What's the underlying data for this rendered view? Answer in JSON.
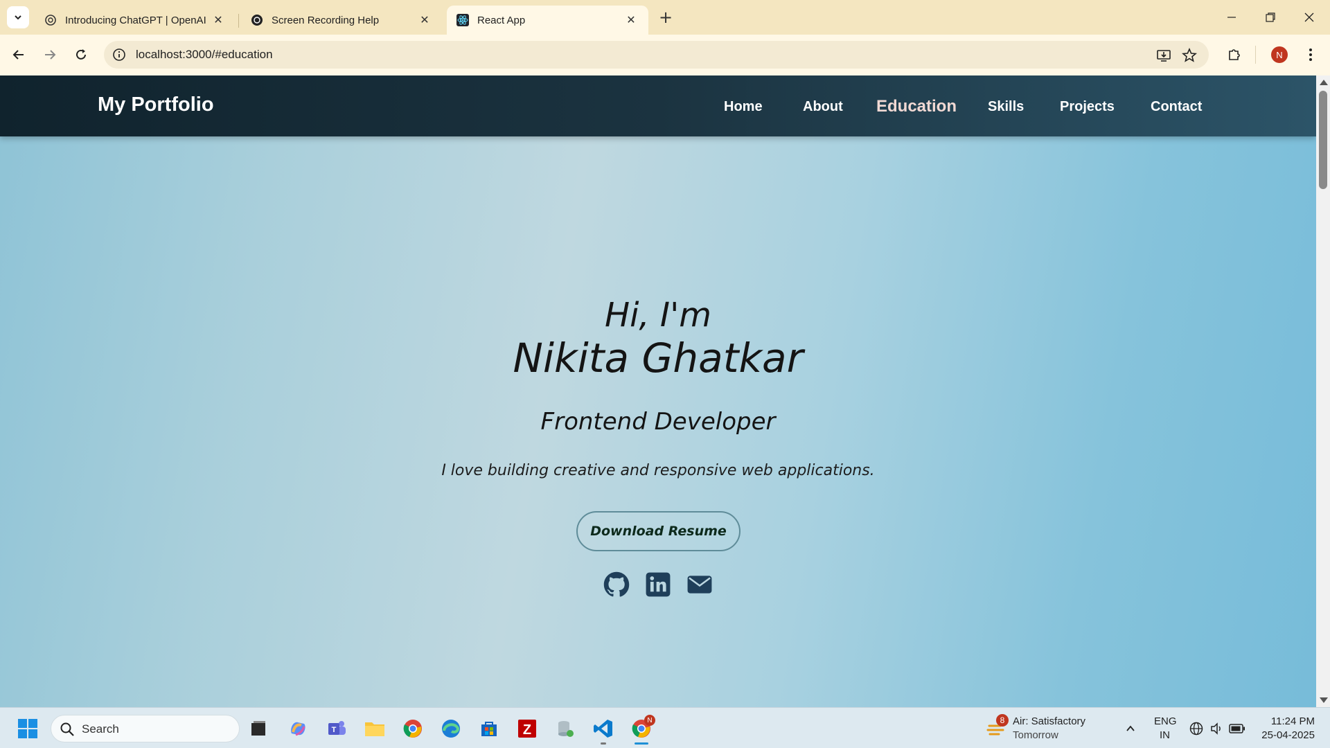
{
  "browser": {
    "tabs": [
      {
        "title": "Introducing ChatGPT | OpenAI",
        "close": "✕"
      },
      {
        "title": "Screen Recording Help",
        "close": "✕"
      },
      {
        "title": "React App",
        "close": "✕"
      }
    ],
    "new_tab": "+",
    "url": "localhost:3000/#education",
    "profile_initial": "N"
  },
  "site": {
    "brand": "My Portfolio",
    "nav": [
      {
        "label": "Home"
      },
      {
        "label": "About"
      },
      {
        "label": "Education"
      },
      {
        "label": "Skills"
      },
      {
        "label": "Projects"
      },
      {
        "label": "Contact"
      }
    ],
    "active_nav": "Education",
    "hero": {
      "greeting": "Hi, I'm",
      "name": "Nikita Ghatkar",
      "role": "Frontend Developer",
      "tagline": "I love building creative and responsive web applications.",
      "cta": "Download Resume"
    },
    "social_icons": [
      "github-icon",
      "linkedin-icon",
      "mail-icon"
    ]
  },
  "taskbar": {
    "search_label": "Search",
    "weather_badge": "8",
    "weather_title": "Air: Satisfactory",
    "weather_sub": "Tomorrow",
    "lang_top": "ENG",
    "lang_bottom": "IN",
    "time": "11:24 PM",
    "date": "25-04-2025",
    "chrome_badge": "N"
  },
  "colors": {
    "navbar": "#1b3340",
    "accent_nav_active": "#f1d9d4",
    "icon_social": "#1f3f5a",
    "tab_strip": "#f4e6c0"
  }
}
